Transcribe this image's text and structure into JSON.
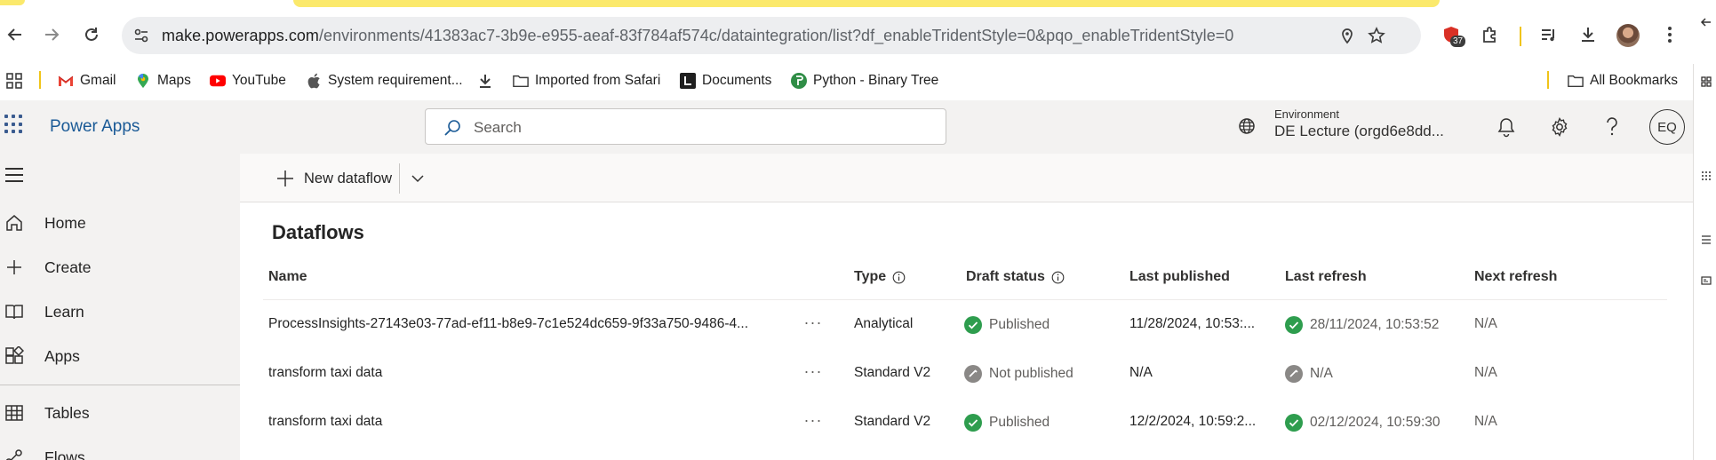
{
  "browser": {
    "url_host": "make.powerapps.com",
    "url_path": "/environments/41383ac7-3b9e-e955-aeaf-83f784af574c/dataintegration/list?df_enableTridentStyle=0&pqo_enableTridentStyle=0",
    "extension_badge": "37"
  },
  "bookmarks": [
    {
      "label": "Gmail"
    },
    {
      "label": "Maps"
    },
    {
      "label": "YouTube"
    },
    {
      "label": "System requirement..."
    },
    {
      "label": "Imported from Safari"
    },
    {
      "label": "Documents"
    },
    {
      "label": "Python - Binary Tree"
    }
  ],
  "bookmarks_all": "All Bookmarks",
  "header": {
    "app_title": "Power Apps",
    "search_placeholder": "Search",
    "environment_label": "Environment",
    "environment_value": "DE Lecture (orgd6e8dd...",
    "user_initials": "EQ"
  },
  "nav": {
    "items": [
      {
        "label": "Home",
        "icon": "home-icon"
      },
      {
        "label": "Create",
        "icon": "plus-icon"
      },
      {
        "label": "Learn",
        "icon": "book-icon"
      },
      {
        "label": "Apps",
        "icon": "apps-icon"
      },
      {
        "label": "Tables",
        "icon": "table-icon"
      },
      {
        "label": "Flows",
        "icon": "flow-icon"
      }
    ]
  },
  "main": {
    "new_dataflow_label": "New dataflow",
    "page_title": "Dataflows",
    "columns": {
      "name": "Name",
      "type": "Type",
      "draft_status": "Draft status",
      "last_published": "Last published",
      "last_refresh": "Last refresh",
      "next_refresh": "Next refresh"
    },
    "rows": [
      {
        "name": "ProcessInsights-27143e03-77ad-ef11-b8e9-7c1e524dc659-9f33a750-9486-4...",
        "more": "···",
        "type": "Analytical",
        "draft_status": "Published",
        "draft_state": "ok",
        "last_published": "11/28/2024, 10:53:...",
        "last_refresh": "28/11/2024, 10:53:52",
        "refresh_state": "ok",
        "next_refresh": "N/A"
      },
      {
        "name": "transform taxi data",
        "more": "···",
        "type": "Standard V2",
        "draft_status": "Not published",
        "draft_state": "none",
        "last_published": "N/A",
        "last_refresh": "N/A",
        "refresh_state": "none",
        "next_refresh": "N/A"
      },
      {
        "name": "transform taxi data",
        "more": "···",
        "type": "Standard V2",
        "draft_status": "Published",
        "draft_state": "ok",
        "last_published": "12/2/2024, 10:59:2...",
        "last_refresh": "02/12/2024, 10:59:30",
        "refresh_state": "ok",
        "next_refresh": "N/A"
      }
    ]
  },
  "colors": {
    "brand_blue": "#1a5a96",
    "success_green": "#2e9d4e",
    "neutral_gray": "#8a8886",
    "bookmark_separator": "#f0c419"
  }
}
